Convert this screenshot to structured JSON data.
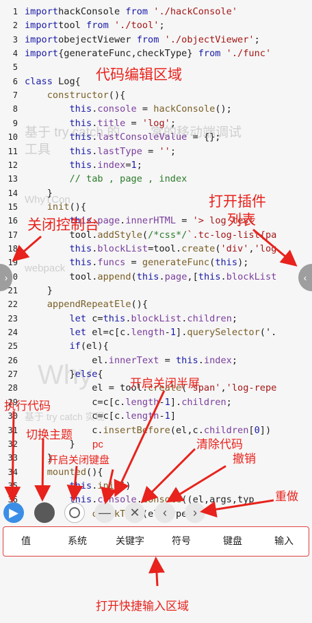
{
  "background": {
    "lines": [
      {
        "text": "基于 try catch 的",
        "extra": "常的移动端调试"
      },
      {
        "text": "工具"
      },
      {
        "text": "WhyTCon"
      },
      {
        "text": "webpack"
      },
      {
        "text": "Why"
      },
      {
        "text": "基于 try catch 实现"
      }
    ]
  },
  "editor": {
    "lines": [
      {
        "n": "1",
        "t": [
          [
            "kw",
            "import"
          ],
          [
            "",
            "hackConsole "
          ],
          [
            "kw",
            "from"
          ],
          [
            "str",
            " './hackConsole'"
          ]
        ]
      },
      {
        "n": "2",
        "t": [
          [
            "kw",
            "import"
          ],
          [
            "",
            "tool "
          ],
          [
            "kw",
            "from"
          ],
          [
            "str",
            " './tool'"
          ],
          [
            "",
            ";"
          ]
        ]
      },
      {
        "n": "3",
        "t": [
          [
            "kw",
            "import"
          ],
          [
            "",
            "obejectViewer "
          ],
          [
            "kw",
            "from"
          ],
          [
            "str",
            " './objectViewer'"
          ],
          [
            "",
            ";"
          ]
        ]
      },
      {
        "n": "4",
        "t": [
          [
            "kw",
            "import"
          ],
          [
            "",
            "{generateFunc,checkType} "
          ],
          [
            "kw",
            "from"
          ],
          [
            "str",
            " './func'"
          ]
        ]
      },
      {
        "n": "5",
        "t": [
          [
            "",
            ""
          ]
        ]
      },
      {
        "n": "6",
        "t": [
          [
            "kw",
            "class"
          ],
          [
            "",
            " Log{"
          ]
        ]
      },
      {
        "n": "7",
        "t": [
          [
            "",
            "    "
          ],
          [
            "fn",
            "constructor"
          ],
          [
            "",
            "(){"
          ]
        ]
      },
      {
        "n": "8",
        "t": [
          [
            "",
            "        "
          ],
          [
            "kw",
            "this"
          ],
          [
            "",
            "."
          ],
          [
            "prop",
            "console"
          ],
          [
            "",
            " = "
          ],
          [
            "fn",
            "hackConsole"
          ],
          [
            "",
            "();"
          ]
        ]
      },
      {
        "n": "9",
        "t": [
          [
            "",
            "        "
          ],
          [
            "kw",
            "this"
          ],
          [
            "",
            "."
          ],
          [
            "prop",
            "title"
          ],
          [
            "",
            " = "
          ],
          [
            "str",
            "'log'"
          ],
          [
            "",
            ";"
          ]
        ]
      },
      {
        "n": "10",
        "t": [
          [
            "",
            "        "
          ],
          [
            "kw",
            "this"
          ],
          [
            "",
            "."
          ],
          [
            "prop",
            "lastConsoleValue"
          ],
          [
            "",
            " = {};"
          ]
        ]
      },
      {
        "n": "11",
        "t": [
          [
            "",
            "        "
          ],
          [
            "kw",
            "this"
          ],
          [
            "",
            "."
          ],
          [
            "prop",
            "lastType"
          ],
          [
            "",
            " = "
          ],
          [
            "str",
            "''"
          ],
          [
            "",
            ";"
          ]
        ]
      },
      {
        "n": "12",
        "t": [
          [
            "",
            "        "
          ],
          [
            "kw",
            "this"
          ],
          [
            "",
            "."
          ],
          [
            "prop",
            "index"
          ],
          [
            "",
            "="
          ],
          [
            "kw",
            "1"
          ],
          [
            "",
            ";"
          ]
        ]
      },
      {
        "n": "13",
        "t": [
          [
            "",
            "        "
          ],
          [
            "cm",
            "// tab , page , index"
          ]
        ]
      },
      {
        "n": "14",
        "t": [
          [
            "",
            "    }"
          ]
        ]
      },
      {
        "n": "15",
        "t": [
          [
            "",
            "    "
          ],
          [
            "fn",
            "init"
          ],
          [
            "",
            "(){"
          ]
        ]
      },
      {
        "n": "16",
        "t": [
          [
            "",
            "        "
          ],
          [
            "kw",
            "this"
          ],
          [
            "",
            "."
          ],
          [
            "prop",
            "page"
          ],
          [
            "",
            "."
          ],
          [
            "prop",
            "innerHTML"
          ],
          [
            "",
            " = "
          ],
          [
            "str",
            "'> log test"
          ]
        ]
      },
      {
        "n": "17",
        "t": [
          [
            "",
            "        tool."
          ],
          [
            "fn",
            "addStyle"
          ],
          [
            "",
            "("
          ],
          [
            "cm",
            "/*css*/"
          ],
          [
            "str",
            "`.tc-log-list{pa"
          ]
        ]
      },
      {
        "n": "18",
        "t": [
          [
            "",
            "        "
          ],
          [
            "kw",
            "this"
          ],
          [
            "",
            "."
          ],
          [
            "prop",
            "blockList"
          ],
          [
            "",
            "=tool."
          ],
          [
            "fn",
            "create"
          ],
          [
            "",
            "("
          ],
          [
            "str",
            "'div'"
          ],
          [
            "",
            ","
          ],
          [
            "str",
            "'log"
          ]
        ]
      },
      {
        "n": "19",
        "t": [
          [
            "",
            "        "
          ],
          [
            "kw",
            "this"
          ],
          [
            "",
            "."
          ],
          [
            "prop",
            "funcs"
          ],
          [
            "",
            " = "
          ],
          [
            "fn",
            "generateFunc"
          ],
          [
            "",
            "("
          ],
          [
            "kw",
            "this"
          ],
          [
            "",
            ");"
          ]
        ]
      },
      {
        "n": "20",
        "t": [
          [
            "",
            "        tool."
          ],
          [
            "fn",
            "append"
          ],
          [
            "",
            "("
          ],
          [
            "kw",
            "this"
          ],
          [
            "",
            "."
          ],
          [
            "prop",
            "page"
          ],
          [
            "",
            ",["
          ],
          [
            "kw",
            "this"
          ],
          [
            "",
            "."
          ],
          [
            "prop",
            "blockList"
          ]
        ]
      },
      {
        "n": "21",
        "t": [
          [
            "",
            "    }"
          ]
        ]
      },
      {
        "n": "22",
        "t": [
          [
            "",
            "    "
          ],
          [
            "fn",
            "appendRepeatEle"
          ],
          [
            "",
            "(){"
          ]
        ]
      },
      {
        "n": "23",
        "t": [
          [
            "",
            "        "
          ],
          [
            "kw",
            "let"
          ],
          [
            "",
            " c="
          ],
          [
            "kw",
            "this"
          ],
          [
            "",
            "."
          ],
          [
            "prop",
            "blockList"
          ],
          [
            "",
            "."
          ],
          [
            "prop",
            "children"
          ],
          [
            "",
            ";"
          ]
        ]
      },
      {
        "n": "24",
        "t": [
          [
            "",
            "        "
          ],
          [
            "kw",
            "let"
          ],
          [
            "",
            " el=c[c."
          ],
          [
            "prop",
            "length"
          ],
          [
            "",
            "-"
          ],
          [
            "kw",
            "1"
          ],
          [
            "",
            "]."
          ],
          [
            "fn",
            "querySelector"
          ],
          [
            "",
            "('."
          ]
        ]
      },
      {
        "n": "25",
        "t": [
          [
            "",
            "        "
          ],
          [
            "kw",
            "if"
          ],
          [
            "",
            "(el){"
          ]
        ]
      },
      {
        "n": "26",
        "t": [
          [
            "",
            "            el."
          ],
          [
            "prop",
            "innerText"
          ],
          [
            "",
            " = "
          ],
          [
            "kw",
            "this"
          ],
          [
            "",
            "."
          ],
          [
            "prop",
            "index"
          ],
          [
            "",
            ";"
          ]
        ]
      },
      {
        "n": "27",
        "t": [
          [
            "",
            "        }"
          ],
          [
            "kw",
            "else"
          ],
          [
            "",
            "{"
          ]
        ]
      },
      {
        "n": "28",
        "t": [
          [
            "",
            "            el = tool."
          ],
          [
            "fn",
            "create"
          ],
          [
            "",
            "("
          ],
          [
            "str",
            "'span'"
          ],
          [
            "",
            ","
          ],
          [
            "str",
            "'log-repe"
          ]
        ]
      },
      {
        "n": "29",
        "t": [
          [
            "",
            "            c=c[c."
          ],
          [
            "prop",
            "length"
          ],
          [
            "",
            "-"
          ],
          [
            "kw",
            "1"
          ],
          [
            "",
            "]."
          ],
          [
            "prop",
            "children"
          ],
          [
            "",
            ";"
          ]
        ]
      },
      {
        "n": "30",
        "t": [
          [
            "",
            "            c=c[c."
          ],
          [
            "prop",
            "length"
          ],
          [
            "",
            "-"
          ],
          [
            "kw",
            "1"
          ],
          [
            "",
            "]"
          ]
        ]
      },
      {
        "n": "31",
        "t": [
          [
            "",
            "            c."
          ],
          [
            "fn",
            "insertBefore"
          ],
          [
            "",
            "(el,c."
          ],
          [
            "prop",
            "children"
          ],
          [
            "",
            "["
          ],
          [
            "kw",
            "0"
          ],
          [
            "",
            "])"
          ]
        ]
      },
      {
        "n": "32",
        "t": [
          [
            "",
            "        }"
          ]
        ]
      },
      {
        "n": "33",
        "t": [
          [
            "",
            "    }"
          ]
        ]
      },
      {
        "n": "34",
        "t": [
          [
            "",
            "    "
          ],
          [
            "fn",
            "mounted"
          ],
          [
            "",
            "(){"
          ]
        ]
      },
      {
        "n": "35",
        "t": [
          [
            "",
            "        "
          ],
          [
            "kw",
            "this"
          ],
          [
            "",
            "."
          ],
          [
            "fn",
            "init"
          ],
          [
            "",
            "()"
          ]
        ]
      },
      {
        "n": "36",
        "t": [
          [
            "",
            "        "
          ],
          [
            "kw",
            "this"
          ],
          [
            "",
            "."
          ],
          [
            "prop",
            "console"
          ],
          [
            "",
            "."
          ],
          [
            "fn",
            "Console"
          ],
          [
            "",
            "((el,args,typ"
          ]
        ]
      },
      {
        "n": "37",
        "t": [
          [
            "",
            "            "
          ],
          [
            "fn",
            "checkType"
          ],
          [
            "",
            "(el,type);"
          ]
        ]
      }
    ]
  },
  "handles": {
    "left_icon": "chevron-right",
    "right_icon": "chevron-left"
  },
  "toolbar": {
    "run_icon": "play-icon",
    "theme_icon": "circle-icon",
    "keyboard_icon": "ring-icon",
    "halfscreen_icon": "minus-icon",
    "clear_icon": "close-icon",
    "undo_icon": "chevron-left-icon",
    "redo_icon": "chevron-right-icon"
  },
  "quick_input": {
    "items": [
      "值",
      "系统",
      "关键字",
      "符号",
      "键盘",
      "输入"
    ]
  },
  "annotations": {
    "editor_area": "代码编辑区域",
    "open_plugins_1": "打开插件",
    "open_plugins_2": "列表",
    "close_console": "关闭控制台",
    "run_code": "执行代码",
    "switch_theme": "切换主题",
    "toggle_keyboard": "开启关闭键盘",
    "pc": "pc",
    "toggle_halfscreen": "开启关闭半屏",
    "clear_code": "清除代码",
    "undo": "撤销",
    "redo": "重做",
    "open_quick_input": "打开快捷输入区域"
  },
  "colors": {
    "annotation": "#e8221c",
    "run_button": "#3a8ee6",
    "keyword": "#1a1aa6"
  }
}
